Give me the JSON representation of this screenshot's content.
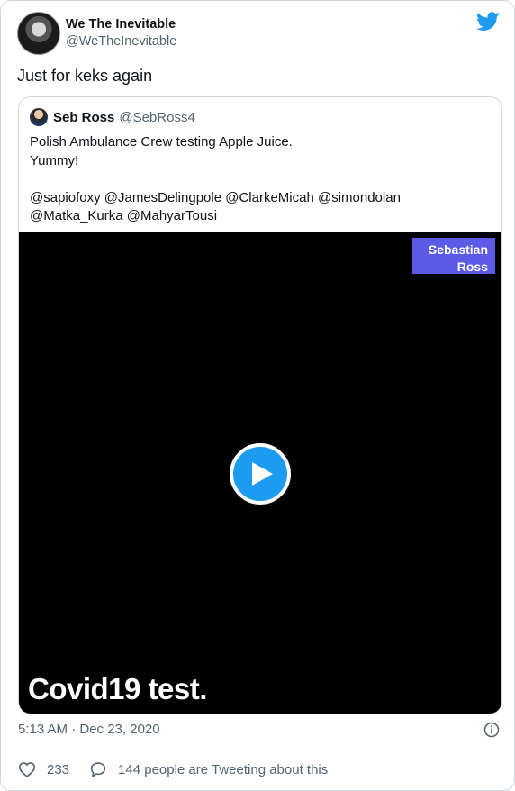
{
  "tweet": {
    "author": {
      "display_name": "We The Inevitable",
      "handle": "@WeTheInevitable",
      "avatar_icon": "profile-photo"
    },
    "text": "Just for keks again",
    "timestamp": "5:13 AM · Dec 23, 2020",
    "likes": "233",
    "retweets_label": "144 people are Tweeting about this",
    "brand_color": "#1d9bf0"
  },
  "quoted": {
    "author": {
      "display_name": "Seb Ross",
      "handle": "@SebRoss4"
    },
    "lines": [
      "Polish Ambulance Crew testing Apple Juice.",
      "Yummy!",
      "",
      "@sapiofoxy @JamesDelingpole @ClarkeMicah @simondolan",
      "@Matka_Kurka @MahyarTousi"
    ],
    "video": {
      "badge_line1": "Sebastian",
      "badge_line2": "Ross",
      "badge_color": "#5b5be8",
      "caption": "Covid19 test.",
      "play_icon": "play-icon"
    }
  }
}
